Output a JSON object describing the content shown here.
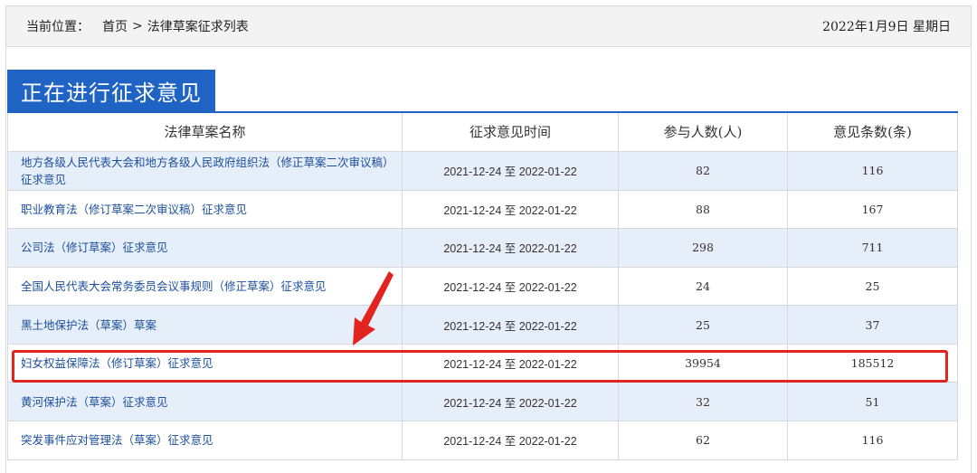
{
  "header": {
    "location_label": "当前位置：",
    "breadcrumb_home": "首页",
    "breadcrumb_sep": ">",
    "breadcrumb_current": "法律草案征求列表",
    "date": "2022年1月9日 星期日"
  },
  "section_title": "正在进行征求意见",
  "table": {
    "columns": [
      "法律草案名称",
      "征求意见时间",
      "参与人数(人)",
      "意见条数(条)"
    ],
    "rows": [
      {
        "name": "地方各级人民代表大会和地方各级人民政府组织法（修正草案二次审议稿）征求意见",
        "time": "2021-12-24 至 2022-01-22",
        "participants": "82",
        "opinions": "116"
      },
      {
        "name": "职业教育法（修订草案二次审议稿）征求意见",
        "time": "2021-12-24 至 2022-01-22",
        "participants": "88",
        "opinions": "167"
      },
      {
        "name": "公司法（修订草案）征求意见",
        "time": "2021-12-24 至 2022-01-22",
        "participants": "298",
        "opinions": "711"
      },
      {
        "name": "全国人民代表大会常务委员会议事规则（修正草案）征求意见",
        "time": "2021-12-24 至 2022-01-22",
        "participants": "24",
        "opinions": "25"
      },
      {
        "name": "黑土地保护法（草案）草案",
        "time": "2021-12-24 至 2022-01-22",
        "participants": "25",
        "opinions": "37"
      },
      {
        "name": "妇女权益保障法（修订草案）征求意见",
        "time": "2021-12-24 至 2022-01-22",
        "participants": "39954",
        "opinions": "185512"
      },
      {
        "name": "黄河保护法（草案）征求意见",
        "time": "2021-12-24 至 2022-01-22",
        "participants": "32",
        "opinions": "51"
      },
      {
        "name": "突发事件应对管理法（草案）征求意见",
        "time": "2021-12-24 至 2022-01-22",
        "participants": "62",
        "opinions": "116"
      }
    ]
  },
  "annotation_color": "#e32320",
  "accent_color": "#1f63c5"
}
